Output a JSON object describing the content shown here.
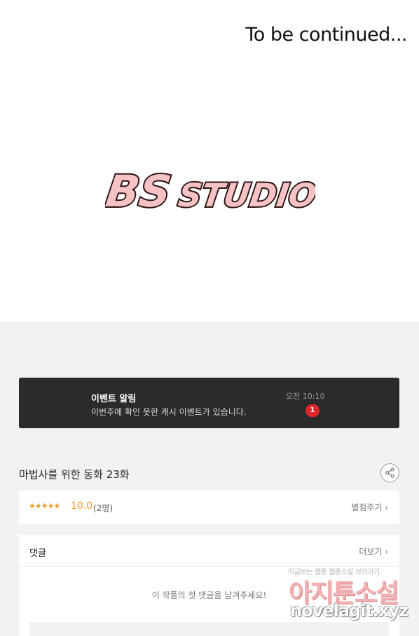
{
  "comic": {
    "caption": "To be continued...",
    "logo_text_1": "BS",
    "logo_text_2": "STUDIO"
  },
  "event": {
    "title": "이벤트 알림",
    "description": "이번주에 확인 못한 캐시 이벤트가 있습니다.",
    "time": "오전 10:10",
    "badge_count": "1"
  },
  "episode": {
    "title": "마법사를 위한 동화 23화",
    "share_icon": "share-icon"
  },
  "rating": {
    "stars": "★★★★★",
    "score": "10.0",
    "count": "(2명)",
    "rate_button": "별점주기 ›"
  },
  "comments": {
    "title": "댓글",
    "more_button": "더보기 ›",
    "empty_message": "이 작품의 첫 댓글을 남겨주세요!"
  },
  "watermark": {
    "tagline": "지금보는 웹툰 웹툰소설 보러가기",
    "site_name": "아지툰소설",
    "url": "novelagit.xyz"
  },
  "colors": {
    "accent": "#f29a1f",
    "badge": "#e0262b",
    "banner_bg": "#2b2b2b",
    "logo_fill": "#f6c2c4"
  }
}
